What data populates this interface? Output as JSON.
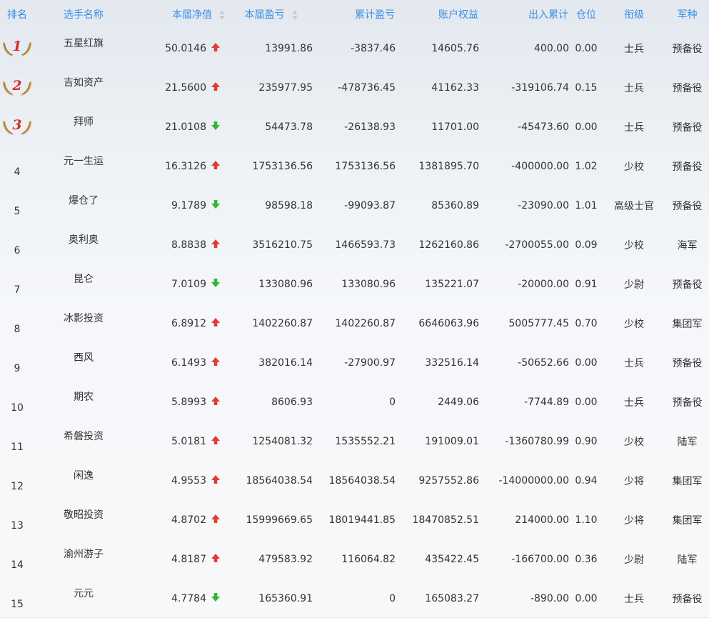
{
  "headers": {
    "rank": "排名",
    "name": "选手名称",
    "nav": "本届净值",
    "pnl": "本届盈亏",
    "cum_pnl": "累计盈亏",
    "equity": "账户权益",
    "inout": "出入累计",
    "position": "仓位",
    "grade": "衔级",
    "branch": "军种"
  },
  "colors": {
    "header": "#3a8ee6",
    "up": "#e53935",
    "down": "#2eb82e",
    "medal_num": "#d62b2b",
    "laurel": "#c79a4a"
  },
  "rows": [
    {
      "rank": "1",
      "name": "五星红旗",
      "nav": "50.0146",
      "trend": "up",
      "pnl": "13991.86",
      "cum_pnl": "-3837.46",
      "equity": "14605.76",
      "inout": "400.00",
      "position": "0.00",
      "grade": "士兵",
      "branch": "预备役"
    },
    {
      "rank": "2",
      "name": "吉如资产",
      "nav": "21.5600",
      "trend": "up",
      "pnl": "235977.95",
      "cum_pnl": "-478736.45",
      "equity": "41162.33",
      "inout": "-319106.74",
      "position": "0.15",
      "grade": "士兵",
      "branch": "预备役"
    },
    {
      "rank": "3",
      "name": "拜师",
      "nav": "21.0108",
      "trend": "down",
      "pnl": "54473.78",
      "cum_pnl": "-26138.93",
      "equity": "11701.00",
      "inout": "-45473.60",
      "position": "0.00",
      "grade": "士兵",
      "branch": "预备役"
    },
    {
      "rank": "4",
      "name": "元一生运",
      "nav": "16.3126",
      "trend": "up",
      "pnl": "1753136.56",
      "cum_pnl": "1753136.56",
      "equity": "1381895.70",
      "inout": "-400000.00",
      "position": "1.02",
      "grade": "少校",
      "branch": "预备役"
    },
    {
      "rank": "5",
      "name": "爆仓了",
      "nav": "9.1789",
      "trend": "down",
      "pnl": "98598.18",
      "cum_pnl": "-99093.87",
      "equity": "85360.89",
      "inout": "-23090.00",
      "position": "1.01",
      "grade": "高级士官",
      "branch": "预备役"
    },
    {
      "rank": "6",
      "name": "奥利奥",
      "nav": "8.8838",
      "trend": "up",
      "pnl": "3516210.75",
      "cum_pnl": "1466593.73",
      "equity": "1262160.86",
      "inout": "-2700055.00",
      "position": "0.09",
      "grade": "少校",
      "branch": "海军"
    },
    {
      "rank": "7",
      "name": "昆仑",
      "nav": "7.0109",
      "trend": "down",
      "pnl": "133080.96",
      "cum_pnl": "133080.96",
      "equity": "135221.07",
      "inout": "-20000.00",
      "position": "0.91",
      "grade": "少尉",
      "branch": "预备役"
    },
    {
      "rank": "8",
      "name": "冰影投资",
      "nav": "6.8912",
      "trend": "up",
      "pnl": "1402260.87",
      "cum_pnl": "1402260.87",
      "equity": "6646063.96",
      "inout": "5005777.45",
      "position": "0.70",
      "grade": "少校",
      "branch": "集团军"
    },
    {
      "rank": "9",
      "name": "西风",
      "nav": "6.1493",
      "trend": "up",
      "pnl": "382016.14",
      "cum_pnl": "-27900.97",
      "equity": "332516.14",
      "inout": "-50652.66",
      "position": "0.00",
      "grade": "士兵",
      "branch": "预备役"
    },
    {
      "rank": "10",
      "name": "期农",
      "nav": "5.8993",
      "trend": "up",
      "pnl": "8606.93",
      "cum_pnl": "0",
      "equity": "2449.06",
      "inout": "-7744.89",
      "position": "0.00",
      "grade": "士兵",
      "branch": "预备役"
    },
    {
      "rank": "11",
      "name": "希磐投资",
      "nav": "5.0181",
      "trend": "up",
      "pnl": "1254081.32",
      "cum_pnl": "1535552.21",
      "equity": "191009.01",
      "inout": "-1360780.99",
      "position": "0.90",
      "grade": "少校",
      "branch": "陆军"
    },
    {
      "rank": "12",
      "name": "闲逸",
      "nav": "4.9553",
      "trend": "up",
      "pnl": "18564038.54",
      "cum_pnl": "18564038.54",
      "equity": "9257552.86",
      "inout": "-14000000.00",
      "position": "0.94",
      "grade": "少将",
      "branch": "集团军"
    },
    {
      "rank": "13",
      "name": "敬昭投资",
      "nav": "4.8702",
      "trend": "up",
      "pnl": "15999669.65",
      "cum_pnl": "18019441.85",
      "equity": "18470852.51",
      "inout": "214000.00",
      "position": "1.10",
      "grade": "少将",
      "branch": "集团军"
    },
    {
      "rank": "14",
      "name": "渝州游子",
      "nav": "4.8187",
      "trend": "up",
      "pnl": "479583.92",
      "cum_pnl": "116064.82",
      "equity": "435422.45",
      "inout": "-166700.00",
      "position": "0.36",
      "grade": "少尉",
      "branch": "陆军"
    },
    {
      "rank": "15",
      "name": "元元",
      "nav": "4.7784",
      "trend": "down",
      "pnl": "165360.91",
      "cum_pnl": "0",
      "equity": "165083.27",
      "inout": "-890.00",
      "position": "0.00",
      "grade": "士兵",
      "branch": "预备役"
    }
  ]
}
